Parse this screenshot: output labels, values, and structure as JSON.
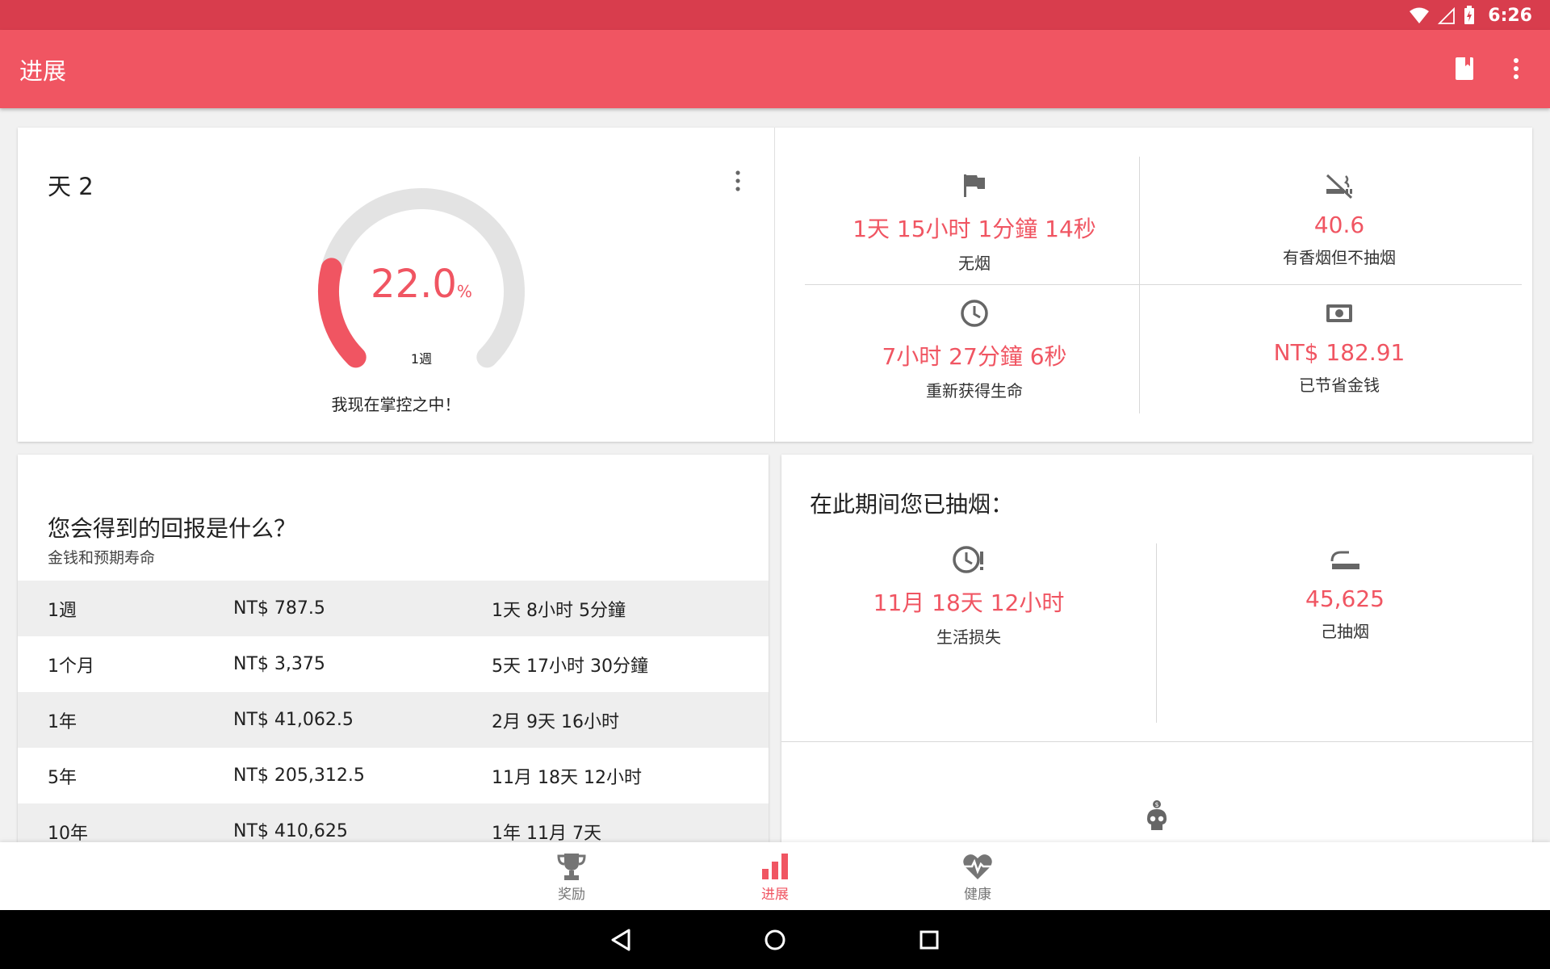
{
  "status_bar": {
    "time": "6:26"
  },
  "app_bar": {
    "title": "进展"
  },
  "progress_card": {
    "day_label": "天 2",
    "gauge_percent": "22.0",
    "gauge_unit": "%",
    "gauge_fill_fraction": 0.22,
    "gauge_target": "1週",
    "status_message": "我现在掌控之中！"
  },
  "stats": [
    {
      "icon": "flag-icon",
      "value": "1天 15小时 1分鐘 14秒",
      "label": "无烟"
    },
    {
      "icon": "no-smoking-icon",
      "value": "40.6",
      "label": "有香烟但不抽烟"
    },
    {
      "icon": "clock-icon",
      "value": "7小时 27分鐘 6秒",
      "label": "重新获得生命"
    },
    {
      "icon": "money-icon",
      "value": "NT$ 182.91",
      "label": "已节省金钱"
    }
  ],
  "rewards": {
    "title": "您会得到的回报是什么？",
    "subtitle": "金钱和预期寿命",
    "rows": [
      {
        "period": "1週",
        "money": "NT$ 787.5",
        "life": "1天 8小时 5分鐘"
      },
      {
        "period": "1个月",
        "money": "NT$ 3,375",
        "life": "5天 17小时 30分鐘"
      },
      {
        "period": "1年",
        "money": "NT$ 41,062.5",
        "life": "2月 9天 16小时"
      },
      {
        "period": "5年",
        "money": "NT$ 205,312.5",
        "life": "11月 18天 12小时"
      },
      {
        "period": "10年",
        "money": "NT$ 410,625",
        "life": "1年 11月 7天"
      }
    ]
  },
  "smoked": {
    "title": "在此期间您已抽烟：",
    "items": [
      {
        "icon": "clock-alert-icon",
        "value": "11月 18天 12小时",
        "label": "生活损失"
      },
      {
        "icon": "cigarette-icon",
        "value": "45,625",
        "label": "己抽烟"
      }
    ]
  },
  "bottom_nav": [
    {
      "icon": "trophy-icon",
      "label": "奖励",
      "active": false
    },
    {
      "icon": "bar-chart-icon",
      "label": "进展",
      "active": true
    },
    {
      "icon": "heart-pulse-icon",
      "label": "健康",
      "active": false
    }
  ],
  "colors": {
    "accent": "#f05562",
    "status_bar": "#d83d4d"
  }
}
